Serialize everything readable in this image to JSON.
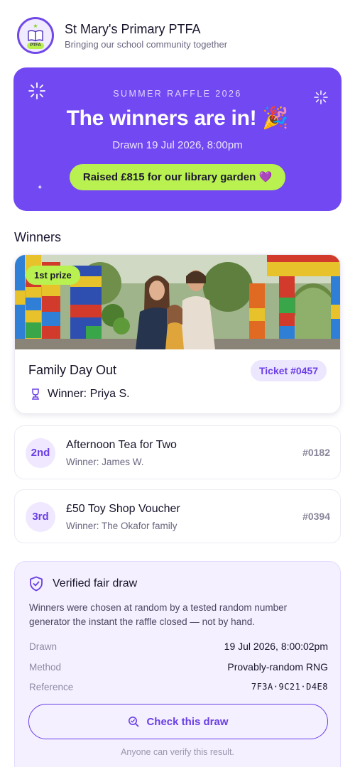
{
  "header": {
    "school_name": "St Mary's Primary PTFA",
    "tagline": "Bringing our school community together",
    "logo_badge": "PTFA"
  },
  "hero": {
    "eyebrow": "SUMMER RAFFLE 2026",
    "title": "The winners are in! 🎉",
    "drawn": "Drawn 19 Jul 2026, 8:00pm",
    "raised": "Raised £815 for our library garden 💜"
  },
  "winners": {
    "section_title": "Winners",
    "first": {
      "badge": "1st prize",
      "title": "Family Day Out",
      "ticket": "Ticket #0457",
      "winner": "Winner: Priya S."
    },
    "others": [
      {
        "place": "2nd",
        "title": "Afternoon Tea for Two",
        "winner": "Winner: James W.",
        "ticket": "#0182"
      },
      {
        "place": "3rd",
        "title": "£50 Toy Shop Voucher",
        "winner": "Winner: The Okafor family",
        "ticket": "#0394"
      }
    ]
  },
  "verify": {
    "title": "Verified fair draw",
    "description": "Winners were chosen at random by a tested random number generator the instant the raffle closed — not by hand.",
    "rows": [
      {
        "label": "Drawn",
        "value": "19 Jul 2026, 8:00:02pm"
      },
      {
        "label": "Method",
        "value": "Provably-random RNG"
      },
      {
        "label": "Reference",
        "value": "7F3A·9C21·D4E8"
      }
    ],
    "button_label": "Check this draw",
    "footnote": "Anyone can verify this result."
  },
  "colors": {
    "brand_purple": "#7248f2",
    "accent_lime": "#b8f150",
    "link_purple": "#6a3fe6"
  }
}
